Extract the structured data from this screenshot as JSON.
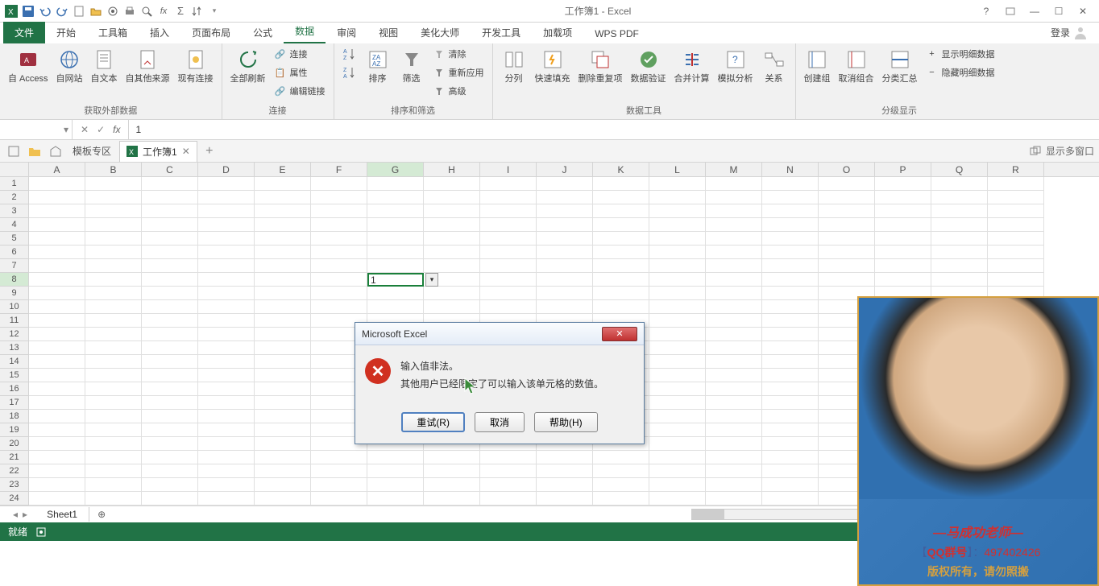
{
  "window": {
    "title": "工作簿1 - Excel",
    "login": "登录"
  },
  "qat_icons": [
    "excel",
    "save",
    "undo",
    "redo",
    "new",
    "open",
    "touch",
    "print",
    "printpreview",
    "fx",
    "autosum",
    "sort"
  ],
  "tabs": {
    "file": "文件",
    "start": "开始",
    "toolbox": "工具箱",
    "insert": "插入",
    "pagelayout": "页面布局",
    "formulas": "公式",
    "data": "数据",
    "review": "审阅",
    "view": "视图",
    "beautify": "美化大师",
    "dev": "开发工具",
    "addins": "加载项",
    "wps": "WPS PDF"
  },
  "ribbon": {
    "g1": {
      "label": "获取外部数据",
      "btns": [
        "自 Access",
        "自网站",
        "自文本",
        "自其他来源",
        "现有连接"
      ]
    },
    "g2": {
      "label": "连接",
      "main": "全部刷新",
      "small": [
        "连接",
        "属性",
        "编辑链接"
      ]
    },
    "g3": {
      "label": "排序和筛选",
      "sortaz": "A→Z",
      "sortza": "Z→A",
      "sort": "排序",
      "filter": "筛选",
      "clear": "清除",
      "reapply": "重新应用",
      "adv": "高级"
    },
    "g4": {
      "label": "数据工具",
      "btns": [
        "分列",
        "快速填充",
        "删除重复项",
        "数据验证",
        "合并计算",
        "模拟分析",
        "关系"
      ]
    },
    "g5": {
      "label": "分级显示",
      "btns": [
        "创建组",
        "取消组合",
        "分类汇总"
      ],
      "small": [
        "显示明细数据",
        "隐藏明细数据"
      ]
    }
  },
  "formulabar": {
    "namebox": "",
    "value": "1"
  },
  "doctabs": {
    "template": "模板专区",
    "active": "工作簿1",
    "showmulti": "显示多窗口"
  },
  "columns": [
    "A",
    "B",
    "C",
    "D",
    "E",
    "F",
    "G",
    "H",
    "I",
    "J",
    "K",
    "L",
    "M",
    "N",
    "O",
    "P",
    "Q",
    "R"
  ],
  "rowcount": 24,
  "activecell": {
    "ref": "G8",
    "value": "1"
  },
  "sheettabs": {
    "sheet": "Sheet1"
  },
  "statusbar": {
    "ready": "就绪"
  },
  "dialog": {
    "title": "Microsoft Excel",
    "line1": "输入值非法。",
    "line2": "其他用户已经限定了可以输入该单元格的数值。",
    "retry": "重试(R)",
    "cancel": "取消",
    "help": "帮助(H)"
  },
  "watermark": {
    "name": "—马成功老师—",
    "qq_label_l": "【",
    "qq_label": "QQ群号",
    "qq_label_r": "】：",
    "qq_num": "497402426",
    "copyright": "版权所有，请勿照搬"
  }
}
